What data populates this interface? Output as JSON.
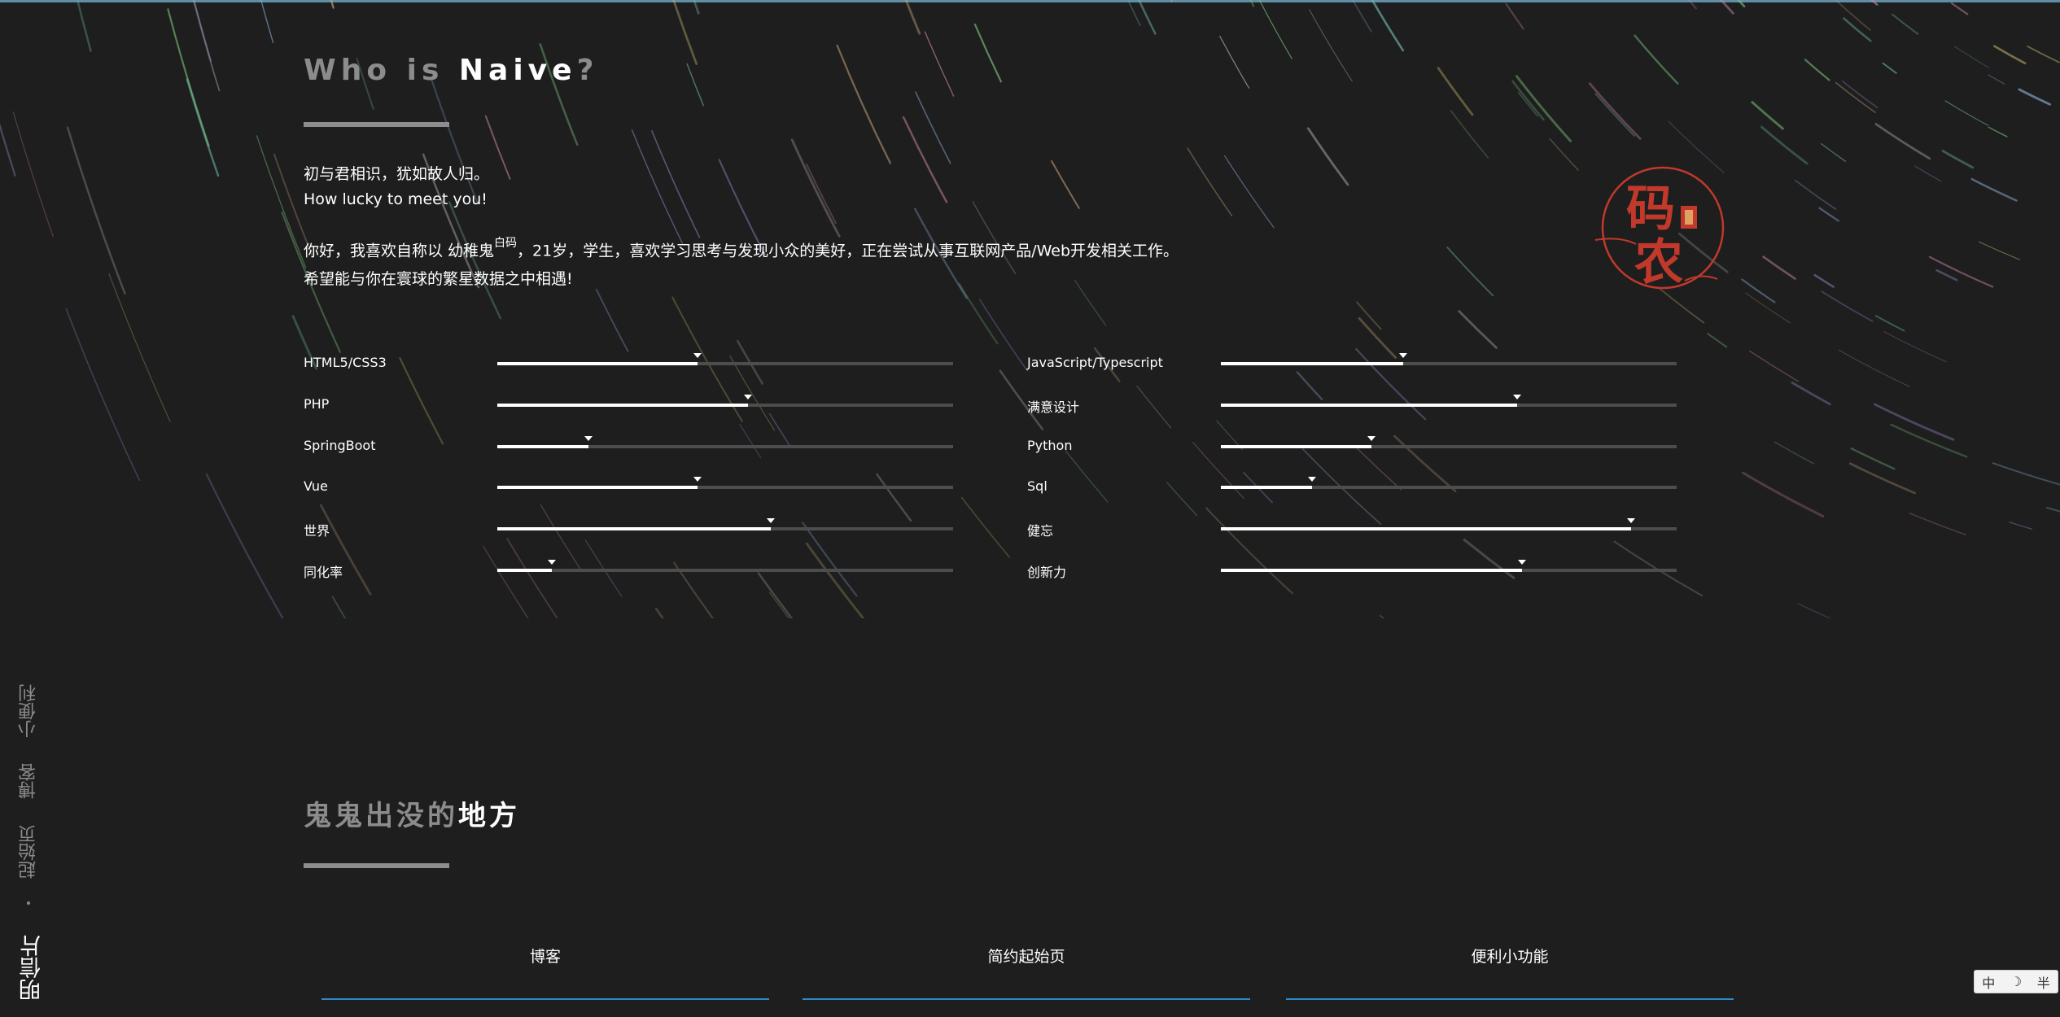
{
  "about": {
    "title_part1": "Who is ",
    "title_part2": "Naive",
    "title_part3": "?",
    "intro_line1": "初与君相识，犹如故人归。",
    "intro_line2": "How lucky to meet you!",
    "desc_line1_a": "你好，我喜欢自称以 幼稚鬼",
    "desc_line1_sup": "白码",
    "desc_line1_b": "，21岁，学生，喜欢学习思考与发现小众的美好，正在尝试从事互联网产品/Web开发相关工作。",
    "desc_line2": "希望能与你在寰球的繁星数据之中相遇!"
  },
  "seal": {
    "line1": "码",
    "line2": "农",
    "color": "#c0392b"
  },
  "skills": {
    "left": [
      {
        "name": "HTML5/CSS3",
        "level": 0.44
      },
      {
        "name": "PHP",
        "level": 0.55
      },
      {
        "name": "SpringBoot",
        "level": 0.2
      },
      {
        "name": "Vue",
        "level": 0.44
      },
      {
        "name": "世界",
        "level": 0.6
      },
      {
        "name": "同化率",
        "level": 0.12
      }
    ],
    "right": [
      {
        "name": "JavaScript/Typescript",
        "level": 0.4
      },
      {
        "name": "满意设计",
        "level": 0.65
      },
      {
        "name": "Python",
        "level": 0.33
      },
      {
        "name": "Sql",
        "level": 0.2
      },
      {
        "name": "健忘",
        "level": 0.9
      },
      {
        "name": "创新力",
        "level": 0.66
      }
    ]
  },
  "places": {
    "title_part1": "鬼鬼出没的",
    "title_part2": "地方",
    "cards": [
      {
        "label": "博客"
      },
      {
        "label": "简约起始页"
      },
      {
        "label": "便利小功能"
      }
    ]
  },
  "side_nav": {
    "items": [
      {
        "label": "小便利"
      },
      {
        "label": "博客"
      },
      {
        "label": "起始页"
      },
      {
        "label": "明信片"
      }
    ]
  },
  "ime": {
    "lang": "中",
    "moon": "☽",
    "mode": "半"
  },
  "colors": {
    "background": "#1e1e1f",
    "accent": "#2d89c7",
    "rule": "#8d8d8d"
  }
}
